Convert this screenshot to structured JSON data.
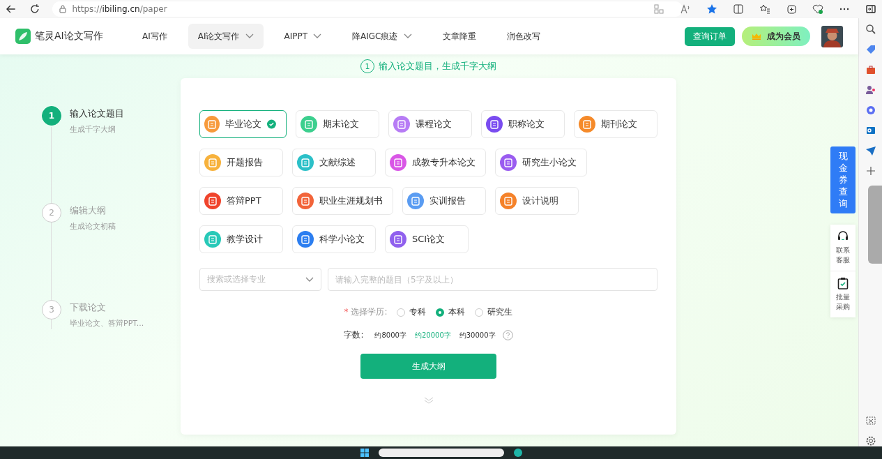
{
  "browser": {
    "url_host": "https://ibiling.cn",
    "url_path": "/paper"
  },
  "header": {
    "logo": "笔灵AI论文写作",
    "nav": [
      {
        "label": "AI写作",
        "dropdown": false,
        "selected": false
      },
      {
        "label": "AI论文写作",
        "dropdown": true,
        "selected": true
      },
      {
        "label": "AIPPT",
        "dropdown": true,
        "selected": false
      },
      {
        "label": "降AIGC痕迹",
        "dropdown": true,
        "selected": false
      },
      {
        "label": "文章降重",
        "dropdown": false,
        "selected": false
      },
      {
        "label": "润色改写",
        "dropdown": false,
        "selected": false
      }
    ],
    "order_button": "查询订单",
    "member_button": "成为会员"
  },
  "banner": {
    "number": "1",
    "text": "输入论文题目，生成千字大纲"
  },
  "steps": [
    {
      "number": "1",
      "title": "输入论文题目",
      "subtitle": "生成千字大纲",
      "selected": true
    },
    {
      "number": "2",
      "title": "编辑大纲",
      "subtitle": "生成论文初稿",
      "selected": false
    },
    {
      "number": "3",
      "title": "下载论文",
      "subtitle": "毕业论文、答辩PPT...",
      "selected": false
    }
  ],
  "paper_types": [
    [
      {
        "label": "毕业论文",
        "color": "#f79a3c",
        "selected": true
      },
      {
        "label": "期末论文",
        "color": "#3ccf8e",
        "selected": false
      },
      {
        "label": "课程论文",
        "color": "#b77cf5",
        "selected": false
      },
      {
        "label": "职称论文",
        "color": "#7a4cf0",
        "selected": false
      },
      {
        "label": "期刊论文",
        "color": "#f58a2a",
        "selected": false
      }
    ],
    [
      {
        "label": "开题报告",
        "color": "#f7b23c",
        "selected": false
      },
      {
        "label": "文献综述",
        "color": "#2cc0c8",
        "selected": false
      },
      {
        "label": "成教专升本论文",
        "color": "#d957e6",
        "selected": false
      },
      {
        "label": "研究生小论文",
        "color": "#9a5cf0",
        "selected": false
      }
    ],
    [
      {
        "label": "答辩PPT",
        "color": "#f0442c",
        "selected": false
      },
      {
        "label": "职业生涯规划书",
        "color": "#f2643a",
        "selected": false
      },
      {
        "label": "实训报告",
        "color": "#5a9cf2",
        "selected": false
      },
      {
        "label": "设计说明",
        "color": "#f5822a",
        "selected": false
      }
    ],
    [
      {
        "label": "教学设计",
        "color": "#27c9b8",
        "selected": false
      },
      {
        "label": "科学小论文",
        "color": "#2c7ef0",
        "selected": false
      },
      {
        "label": "SCI论文",
        "color": "#9060ee",
        "selected": false
      }
    ]
  ],
  "major_select": {
    "placeholder": "搜索或选择专业"
  },
  "title_input": {
    "placeholder": "请输入完整的题目（5字及以上）"
  },
  "education": {
    "label": "选择学历:",
    "required_mark": "*",
    "options": [
      {
        "label": "专科",
        "selected": false
      },
      {
        "label": "本科",
        "selected": true
      },
      {
        "label": "研究生",
        "selected": false
      }
    ]
  },
  "word_count": {
    "label": "字数:",
    "options": [
      {
        "label": "约8000字",
        "selected": false
      },
      {
        "label": "约20000字",
        "selected": true
      },
      {
        "label": "约30000字",
        "selected": false
      }
    ]
  },
  "generate_button": "生成大纲",
  "side_float": {
    "coupon": "现金券查询",
    "service": "联系客服",
    "bulk": "批量采购"
  }
}
